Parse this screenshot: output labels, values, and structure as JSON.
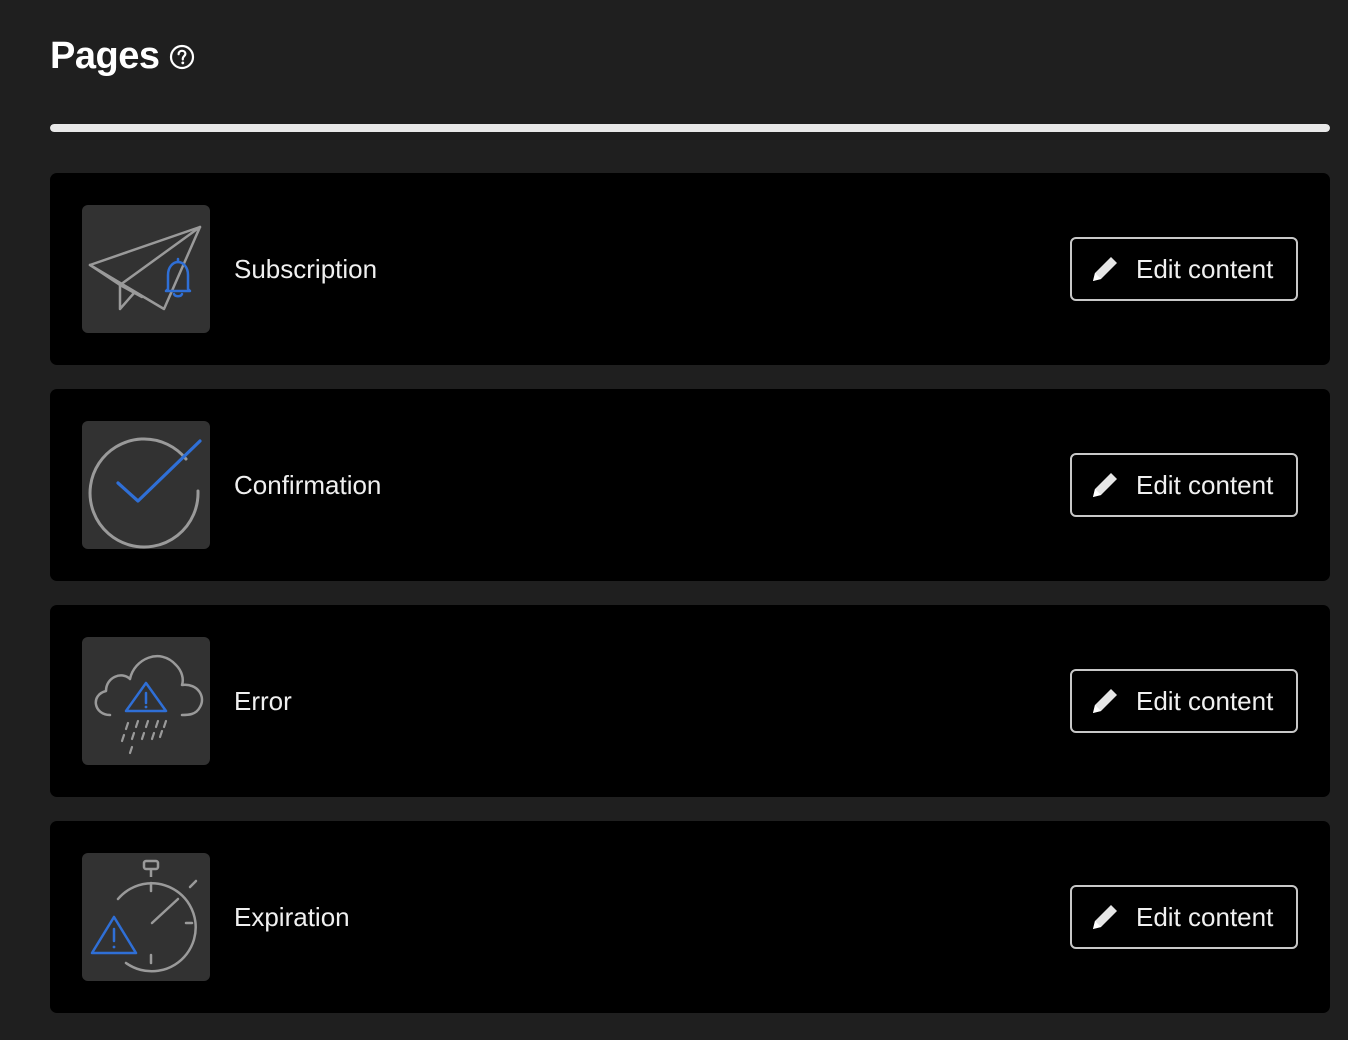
{
  "header": {
    "title": "Pages",
    "help_icon": "help-circle-icon"
  },
  "progress": {
    "fraction": 1.0
  },
  "pages": [
    {
      "label": "Subscription",
      "icon": "paper-plane-bell-icon",
      "button_label": "Edit content",
      "button_icon": "pencil-icon"
    },
    {
      "label": "Confirmation",
      "icon": "checkmark-circle-icon",
      "button_label": "Edit content",
      "button_icon": "pencil-icon"
    },
    {
      "label": "Error",
      "icon": "cloud-alert-icon",
      "button_label": "Edit content",
      "button_icon": "pencil-icon"
    },
    {
      "label": "Expiration",
      "icon": "stopwatch-alert-icon",
      "button_label": "Edit content",
      "button_icon": "pencil-icon"
    }
  ],
  "colors": {
    "background": "#1f1f1f",
    "card": "#000000",
    "thumb": "#323232",
    "accent": "#2f6fd6",
    "line_gray": "#9a9a9a"
  }
}
